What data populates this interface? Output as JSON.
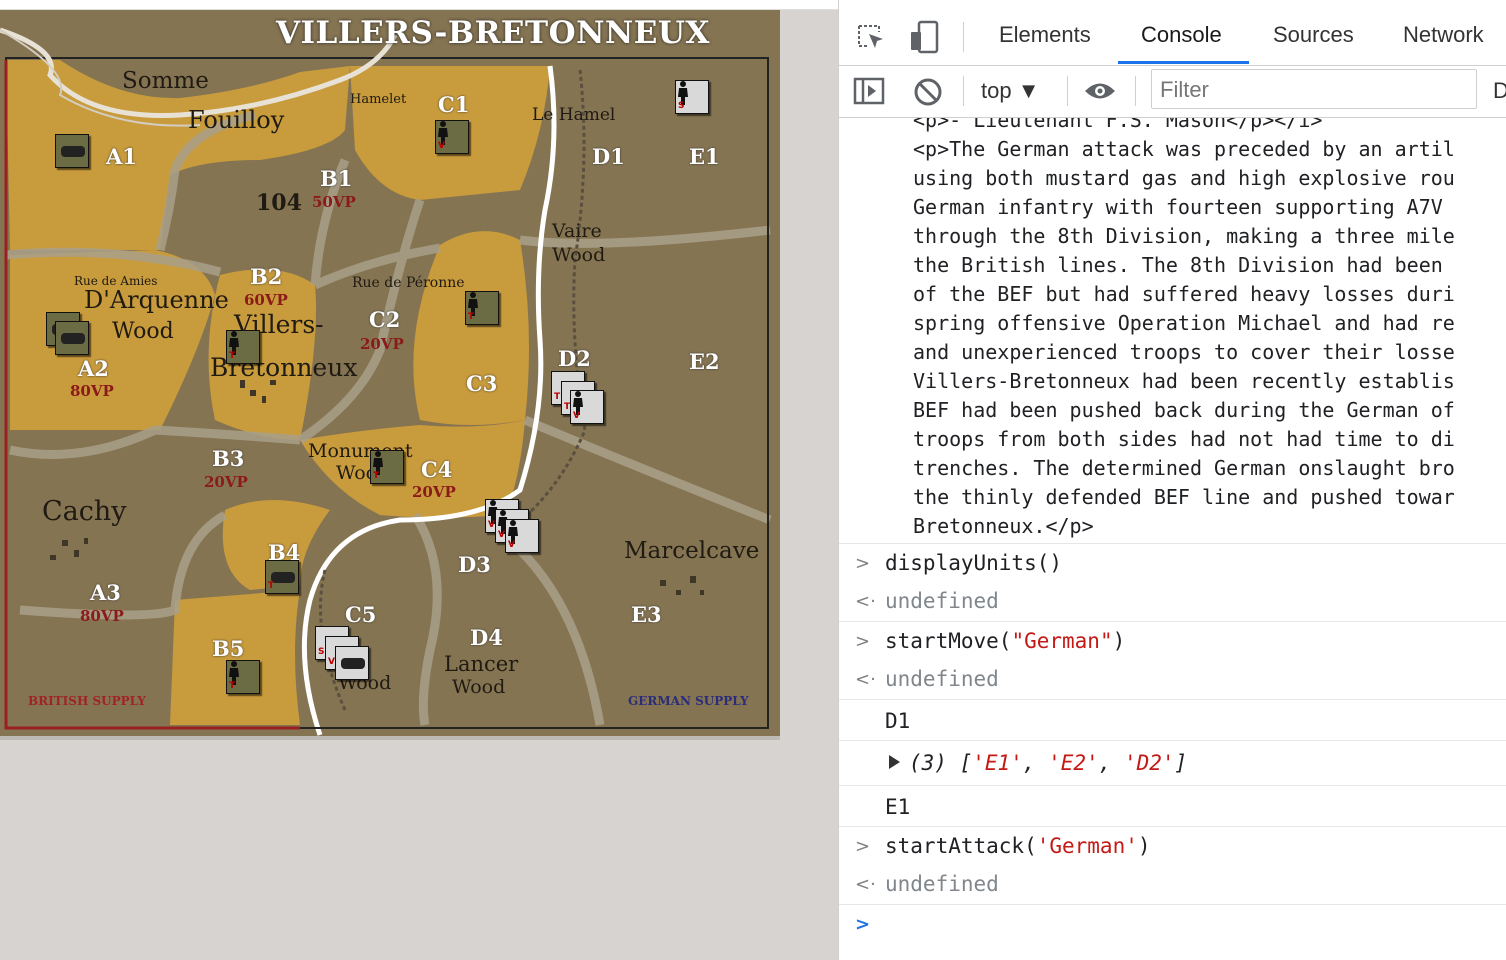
{
  "game": {
    "title": "VILLERS-BRETONNEUX",
    "places": {
      "somme": "Somme",
      "fouilloy": "Fouilloy",
      "hamelet": "Hamelet",
      "le_hamel": "Le Hamel",
      "hill": "104",
      "rue_amies": "Rue de Amies",
      "d_arquenne": "D'Arquenne",
      "wood1": "Wood",
      "villers": "Villers-",
      "bretonneux": "Bretonneux",
      "rue_peronne": "Rue de Péronne",
      "vaire": "Vaire",
      "wood2": "Wood",
      "monument": "Monument",
      "wood3": "Wood",
      "cachy": "Cachy",
      "marcelcave": "Marcelcave",
      "lancer": "Lancer",
      "wood4": "Wood",
      "wood5": "Wood"
    },
    "zones": {
      "A1": "A1",
      "A2": "A2",
      "A3": "A3",
      "B1": "B1",
      "B2": "B2",
      "B3": "B3",
      "B4": "B4",
      "B5": "B5",
      "C1": "C1",
      "C2": "C2",
      "C3": "C3",
      "C4": "C4",
      "C5": "C5",
      "D1": "D1",
      "D2": "D2",
      "D3": "D3",
      "D4": "D4",
      "E1": "E1",
      "E2": "E2",
      "E3": "E3"
    },
    "vp": {
      "B1": "50VP",
      "B2": "60VP",
      "C2": "20VP",
      "A2": "80VP",
      "B3": "20VP",
      "C4": "20VP",
      "A3": "80VP"
    },
    "supply": {
      "british": "BRITISH SUPPLY",
      "german": "GERMAN SUPPLY"
    }
  },
  "devtools": {
    "tabs": [
      "Elements",
      "Console",
      "Sources",
      "Network"
    ],
    "active_tab": "Console",
    "context": "top ▼",
    "filter_placeholder": "Filter",
    "colors": {
      "accent": "#1a73e8",
      "string": "#c41a16",
      "muted": "#80868b"
    },
    "output_lines": [
      "<p>- Lieutenant F.S. Mason</p></i>",
      "<p>The German attack was preceded by an artil",
      "using both mustard gas and high explosive rou",
      "German infantry with fourteen supporting A7V",
      "through the 8th Division, making a three mile",
      "the British lines. The 8th Division had been",
      "of the BEF but had suffered heavy losses duri",
      "spring offensive Operation Michael and had re",
      "and unexperienced troops to cover their losse",
      "Villers-Bretonneux had been recently establis",
      "BEF had been pushed back during the German of",
      "troops from both sides had not had time to di",
      "trenches. The determined German onslaught bro",
      "the thinly defended BEF line and pushed towar",
      "Bretonneux.</p>"
    ],
    "entries": [
      {
        "call": "displayUnits()",
        "result": "undefined"
      },
      {
        "call_fn": "startMove(",
        "call_arg": "\"German\"",
        "call_end": ")",
        "result": "undefined"
      },
      {
        "log": "D1"
      },
      {
        "array_prefix": "(3) [",
        "items": [
          "'E1'",
          "'E2'",
          "'D2'"
        ],
        "array_suffix": "]"
      },
      {
        "log": "E1"
      },
      {
        "call_fn": "startAttack(",
        "call_arg": "'German'",
        "call_end": ")",
        "result": "undefined"
      }
    ],
    "sep": ", "
  }
}
